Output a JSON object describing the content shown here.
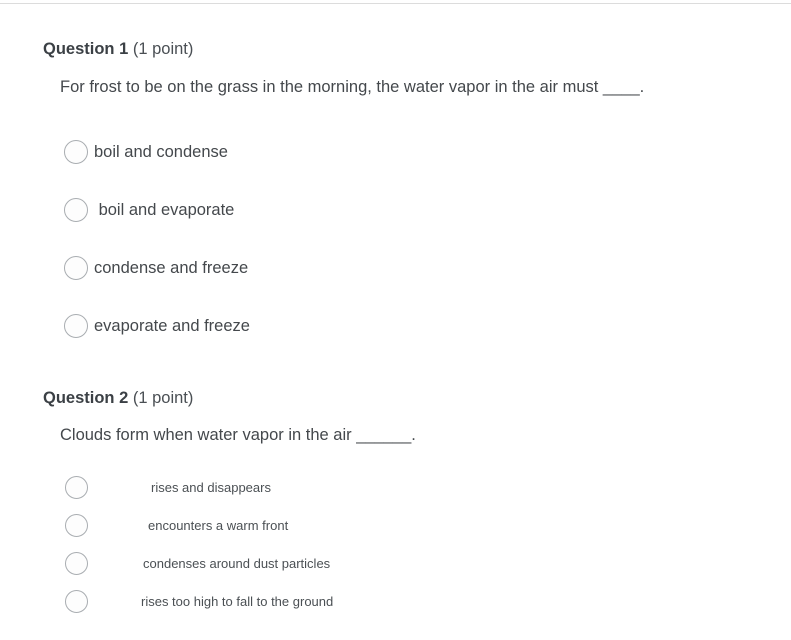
{
  "questions": [
    {
      "label": "Question 1",
      "points": "(1 point)",
      "prompt": "For frost to be on the grass in the morning, the water vapor in the air must ____.",
      "options": [
        {
          "text": "boil and condense"
        },
        {
          "text": " boil and evaporate"
        },
        {
          "text": "condense and freeze"
        },
        {
          "text": "evaporate and freeze"
        }
      ]
    },
    {
      "label": "Question 2",
      "points": "(1 point)",
      "prompt": "Clouds form when water vapor in the air ______.",
      "options": [
        {
          "text": "rises and disappears"
        },
        {
          "text": "encounters a warm front"
        },
        {
          "text": "condenses around dust particles"
        },
        {
          "text": "rises too high to fall to the ground"
        }
      ]
    }
  ],
  "colors": {
    "text": "#44484c",
    "heading": "#3b4045",
    "radio_border": "#a9adb1",
    "rule": "#dcdcdc",
    "background": "#ffffff"
  }
}
